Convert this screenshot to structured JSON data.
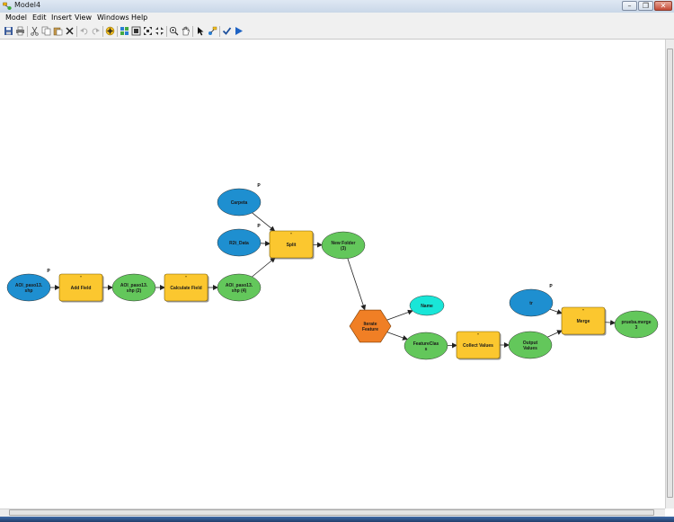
{
  "window": {
    "title": "Model4"
  },
  "menu": [
    "Model",
    "Edit",
    "Insert",
    "View",
    "Windows",
    "Help"
  ],
  "toolbar_icons": [
    "save-icon",
    "print-icon",
    "cut-icon",
    "copy-icon",
    "paste-icon",
    "delete-icon",
    "undo-icon",
    "redo-icon",
    "add-data-icon",
    "auto-layout-icon",
    "full-extent-icon",
    "fixed-zoom-in-icon",
    "fixed-zoom-out-icon",
    "zoom-in-icon",
    "pan-icon",
    "select-icon",
    "connect-icon",
    "validate-icon",
    "run-icon"
  ],
  "colors": {
    "variable": "#1e8fd0",
    "tool": "#fbc72f",
    "derived": "#63c75b",
    "iterator": "#f07f25",
    "boolean": "#19e6d8"
  },
  "model": {
    "nodes": [
      {
        "id": "n1",
        "kind": "variable",
        "label": [
          "AOI_paso13.",
          "shp"
        ],
        "param": "P"
      },
      {
        "id": "n2",
        "kind": "tool",
        "label": [
          "Add Field"
        ]
      },
      {
        "id": "n3",
        "kind": "derived",
        "label": [
          "AOI_paso13.",
          "shp (2)"
        ]
      },
      {
        "id": "n4",
        "kind": "tool",
        "label": [
          "Calculate Field"
        ]
      },
      {
        "id": "n5",
        "kind": "derived",
        "label": [
          "AOI_paso13.",
          "shp (4)"
        ]
      },
      {
        "id": "n6",
        "kind": "variable",
        "label": [
          "Carpeta"
        ],
        "param": "P"
      },
      {
        "id": "n7",
        "kind": "variable",
        "label": [
          "R2t_Data"
        ],
        "param": "P"
      },
      {
        "id": "n8",
        "kind": "tool",
        "label": [
          "Split"
        ]
      },
      {
        "id": "n9",
        "kind": "derived",
        "label": [
          "New Folder",
          "(3)"
        ]
      },
      {
        "id": "n10",
        "kind": "iterator",
        "label": [
          "Iterate",
          "Feature"
        ]
      },
      {
        "id": "n11",
        "kind": "boolean",
        "label": [
          "Name"
        ]
      },
      {
        "id": "n12",
        "kind": "derived",
        "label": [
          "FeatureClas",
          "s"
        ]
      },
      {
        "id": "n13",
        "kind": "tool",
        "label": [
          "Collect Values"
        ]
      },
      {
        "id": "n14",
        "kind": "derived",
        "label": [
          "Output",
          "Values"
        ]
      },
      {
        "id": "n15",
        "kind": "variable",
        "label": [
          "tr"
        ],
        "param": "P"
      },
      {
        "id": "n16",
        "kind": "tool",
        "label": [
          "Merge"
        ]
      },
      {
        "id": "n17",
        "kind": "derived",
        "label": [
          "prueba.merge",
          "3"
        ]
      }
    ],
    "edges": [
      [
        "n1",
        "n2"
      ],
      [
        "n2",
        "n3"
      ],
      [
        "n3",
        "n4"
      ],
      [
        "n4",
        "n5"
      ],
      [
        "n5",
        "n8"
      ],
      [
        "n6",
        "n8"
      ],
      [
        "n7",
        "n8"
      ],
      [
        "n8",
        "n9"
      ],
      [
        "n9",
        "n10"
      ],
      [
        "n10",
        "n11"
      ],
      [
        "n10",
        "n12"
      ],
      [
        "n12",
        "n13"
      ],
      [
        "n13",
        "n14"
      ],
      [
        "n14",
        "n16"
      ],
      [
        "n15",
        "n16"
      ],
      [
        "n16",
        "n17"
      ]
    ]
  }
}
